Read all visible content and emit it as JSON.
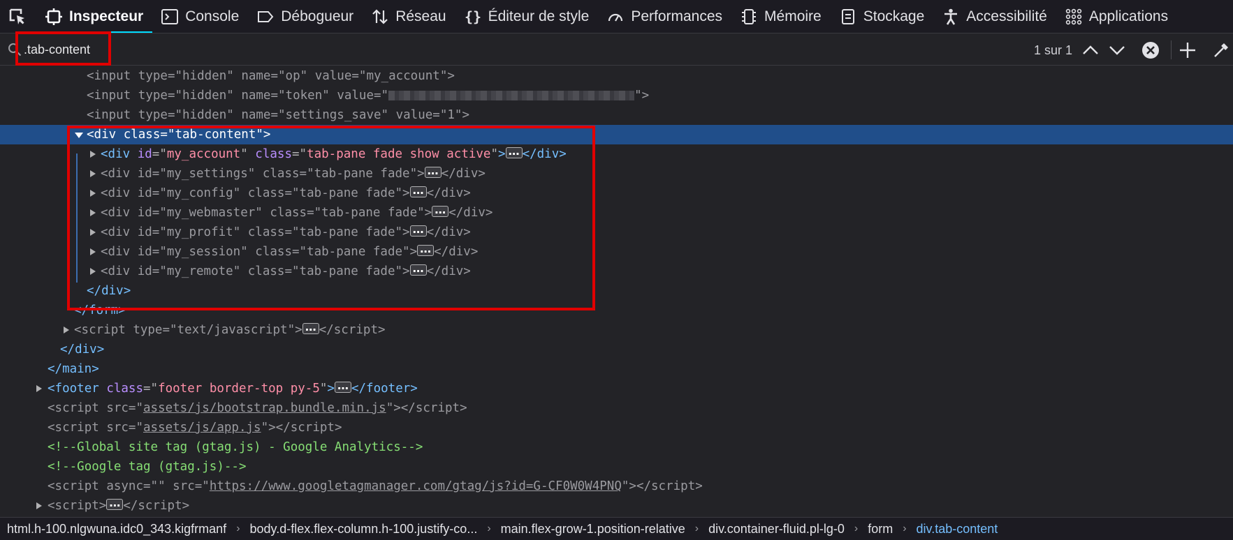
{
  "toolbar": {
    "tabs": [
      {
        "label": "Inspecteur",
        "icon": "inspector-icon"
      },
      {
        "label": "Console",
        "icon": "console-icon"
      },
      {
        "label": "Débogueur",
        "icon": "debugger-icon"
      },
      {
        "label": "Réseau",
        "icon": "network-icon"
      },
      {
        "label": "Éditeur de style",
        "icon": "style-editor-icon"
      },
      {
        "label": "Performances",
        "icon": "performance-icon"
      },
      {
        "label": "Mémoire",
        "icon": "memory-icon"
      },
      {
        "label": "Stockage",
        "icon": "storage-icon"
      },
      {
        "label": "Accessibilité",
        "icon": "accessibility-icon"
      },
      {
        "label": "Applications",
        "icon": "applications-icon"
      }
    ],
    "selected": "Inspecteur"
  },
  "search": {
    "value": ".tab-content",
    "count": "1 sur 1"
  },
  "markup": {
    "l1": {
      "tag": "input",
      "a1": "type",
      "v1": "hidden",
      "a2": "name",
      "v2": "op",
      "a3": "value",
      "v3": "my_account"
    },
    "l2": {
      "tag": "input",
      "a1": "type",
      "v1": "hidden",
      "a2": "name",
      "v2": "token",
      "a3": "value"
    },
    "l3": {
      "tag": "input",
      "a1": "type",
      "v1": "hidden",
      "a2": "name",
      "v2": "settings_save",
      "a3": "value",
      "v3": "1"
    },
    "l4": {
      "tag": "div",
      "a1": "class",
      "v1": "tab-content"
    },
    "l5": {
      "tag": "div",
      "a1": "id",
      "v1": "my_account",
      "a2": "class",
      "v2": "tab-pane fade show active"
    },
    "l6": {
      "tag": "div",
      "a1": "id",
      "v1": "my_settings",
      "a2": "class",
      "v2": "tab-pane fade"
    },
    "l7": {
      "tag": "div",
      "a1": "id",
      "v1": "my_config",
      "a2": "class",
      "v2": "tab-pane fade"
    },
    "l8": {
      "tag": "div",
      "a1": "id",
      "v1": "my_webmaster",
      "a2": "class",
      "v2": "tab-pane fade"
    },
    "l9": {
      "tag": "div",
      "a1": "id",
      "v1": "my_profit",
      "a2": "class",
      "v2": "tab-pane fade"
    },
    "l10": {
      "tag": "div",
      "a1": "id",
      "v1": "my_session",
      "a2": "class",
      "v2": "tab-pane fade"
    },
    "l11": {
      "tag": "div",
      "a1": "id",
      "v1": "my_remote",
      "a2": "class",
      "v2": "tab-pane fade"
    },
    "l12": {
      "close": "div"
    },
    "l13": {
      "close": "form"
    },
    "l14": {
      "tag": "script",
      "a1": "type",
      "v1": "text/javascript"
    },
    "l15": {
      "close": "div"
    },
    "l16": {
      "close": "main"
    },
    "l17": {
      "tag": "footer",
      "a1": "class",
      "v1": "footer border-top py-5"
    },
    "l18": {
      "tag": "script",
      "a1": "src",
      "v1": "assets/js/bootstrap.bundle.min.js"
    },
    "l19": {
      "tag": "script",
      "a1": "src",
      "v1": "assets/js/app.js"
    },
    "l20": {
      "comment": "Global site tag (gtag.js) - Google Analytics"
    },
    "l21": {
      "comment": "Google tag (gtag.js)"
    },
    "l22": {
      "tag": "script",
      "a1": "async",
      "v1": "",
      "a2": "src",
      "v2": "https://www.googletagmanager.com/gtag/js?id=G-CF0W0W4PNQ"
    },
    "l23": {
      "tag": "script"
    }
  },
  "breadcrumb": [
    "html.h-100.nlgwuna.idc0_343.kigfrmanf",
    "body.d-flex.flex-column.h-100.justify-co...",
    "main.flex-grow-1.position-relative",
    "div.container-fluid.pl-lg-0",
    "form",
    "div.tab-content"
  ]
}
